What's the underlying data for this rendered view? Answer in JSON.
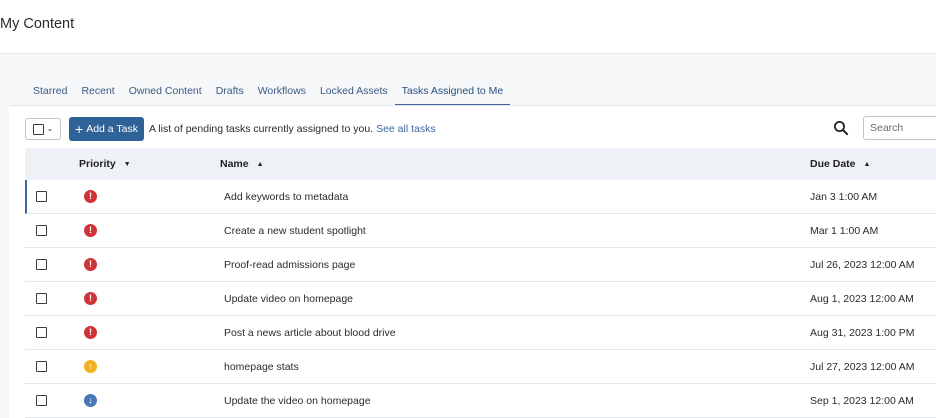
{
  "header": {
    "title": "My Content"
  },
  "tabs": [
    {
      "label": "Starred"
    },
    {
      "label": "Recent"
    },
    {
      "label": "Owned Content"
    },
    {
      "label": "Drafts"
    },
    {
      "label": "Workflows"
    },
    {
      "label": "Locked Assets"
    },
    {
      "label": "Tasks Assigned to Me",
      "active": true
    }
  ],
  "toolbar": {
    "add_task_label": "Add a Task",
    "description": "A list of pending tasks currently assigned to you.",
    "see_all_label": "See all tasks",
    "search_placeholder": "Search"
  },
  "table": {
    "columns": {
      "priority": "Priority",
      "name": "Name",
      "due": "Due Date"
    },
    "rows": [
      {
        "priority": "high",
        "name": "Add keywords to metadata",
        "due": "Jan 3 1:00 AM"
      },
      {
        "priority": "high",
        "name": "Create a new student spotlight",
        "due": "Mar 1 1:00 AM"
      },
      {
        "priority": "high",
        "name": "Proof-read admissions page",
        "due": "Jul 26, 2023 12:00 AM"
      },
      {
        "priority": "high",
        "name": "Update video on homepage",
        "due": "Aug 1, 2023 12:00 AM"
      },
      {
        "priority": "high",
        "name": "Post a news article about blood drive",
        "due": "Aug 31, 2023 1:00 PM"
      },
      {
        "priority": "medium",
        "name": "homepage stats",
        "due": "Jul 27, 2023 12:00 AM"
      },
      {
        "priority": "low",
        "name": "Update the video on homepage",
        "due": "Sep 1, 2023 12:00 AM"
      }
    ]
  },
  "colors": {
    "accent": "#2f6296",
    "priority_high": "#d13438",
    "priority_medium": "#f2b01e",
    "priority_low": "#4a78b5"
  }
}
